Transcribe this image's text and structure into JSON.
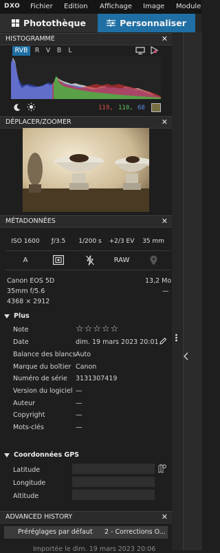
{
  "app": {
    "logo": "DXO"
  },
  "menu": [
    "Fichier",
    "Edition",
    "Affichage",
    "Image",
    "Module"
  ],
  "tabs": {
    "library": "Photothèque",
    "customize": "Personnaliser"
  },
  "histogram": {
    "title": "HISTOGRAMME",
    "channels": [
      "RVB",
      "R",
      "V",
      "B",
      "L"
    ],
    "active_channel": "RVB",
    "rgb_values": {
      "r": "119,",
      "g": "110,",
      "b": "68"
    },
    "swatch_color": "#776e44"
  },
  "navigator": {
    "title": "DÉPLACER/ZOOMER"
  },
  "metadata": {
    "title": "MÉTADONNÉES",
    "exposure": [
      "ISO 1600",
      "ƒ/3.5",
      "1/200 s",
      "+2/3 EV",
      "35 mm"
    ],
    "mode": {
      "program": "A",
      "format": "RAW"
    },
    "camera": "Canon EOS 5D",
    "filesize": "13,2 Mo",
    "lens": "35mm f/5.6",
    "lens_extra": "—",
    "dimensions": "4368 × 2912",
    "more": {
      "title": "Plus",
      "rows": [
        {
          "label": "Note",
          "value": "☆☆☆☆☆"
        },
        {
          "label": "Date",
          "value": "dim. 19 mars 2023 20:01"
        },
        {
          "label": "Balance des blancs",
          "value": "Auto"
        },
        {
          "label": "Marque du boîtier",
          "value": "Canon"
        },
        {
          "label": "Numéro de série",
          "value": "3131307419"
        },
        {
          "label": "Version du logiciel",
          "value": "—"
        },
        {
          "label": "Auteur",
          "value": "—"
        },
        {
          "label": "Copyright",
          "value": "—"
        },
        {
          "label": "Mots-clés",
          "value": "—"
        }
      ]
    },
    "gps": {
      "title": "Coordonnées GPS",
      "fields": [
        "Latitude",
        "Longitude",
        "Altitude"
      ]
    }
  },
  "advanced_history": {
    "title": "ADVANCED HISTORY",
    "left_label": "Préréglages par défaut",
    "right_label": "2 - Corrections O...",
    "footer": "Importée le dim. 19 mars 2023 20:06"
  },
  "colors": {
    "accent": "#1f6fa4",
    "panel": "#1e1e1e",
    "header": "#2b2b2b"
  }
}
